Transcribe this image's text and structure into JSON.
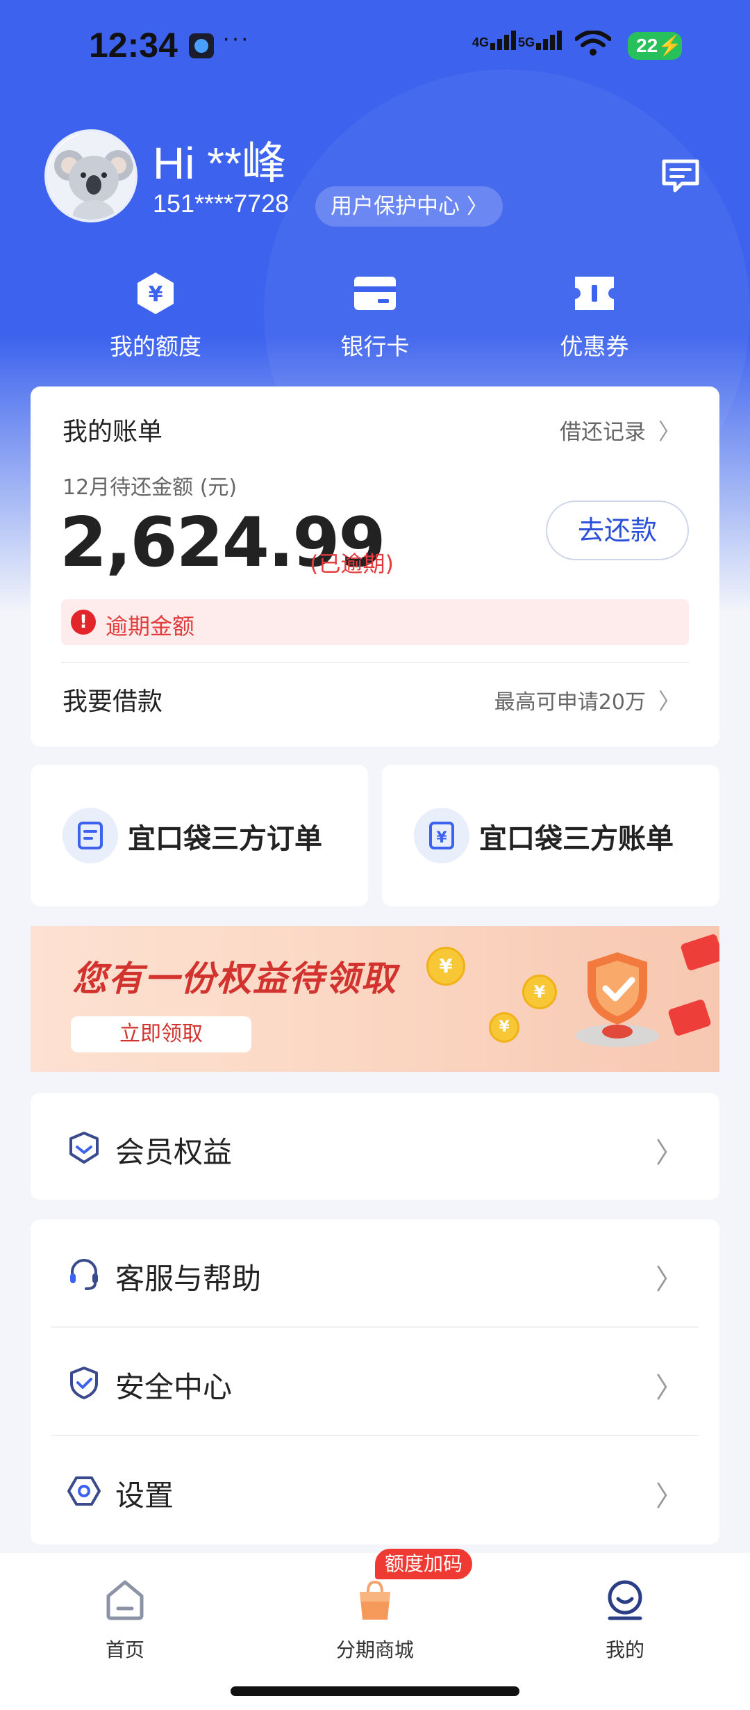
{
  "status_bar": {
    "time": "12:34",
    "network_1": "4G",
    "network_2": "5G",
    "battery": "22"
  },
  "profile": {
    "greeting": "Hi **峰",
    "phone": "151****7728",
    "protection_center": "用户保护中心"
  },
  "quick_actions": [
    {
      "label": "我的额度",
      "icon": "credit-limit-icon"
    },
    {
      "label": "银行卡",
      "icon": "bank-card-icon"
    },
    {
      "label": "优惠券",
      "icon": "coupon-icon"
    }
  ],
  "bill": {
    "title": "我的账单",
    "record_link": "借还记录",
    "subtitle": "12月待还金额 (元)",
    "amount": "2,624.99",
    "status": "(已逾期)",
    "repay_button": "去还款",
    "overdue_label": "逾期金额",
    "borrow_title": "我要借款",
    "borrow_hint": "最高可申请20万"
  },
  "third_party": {
    "orders": "宜口袋三方订单",
    "bills": "宜口袋三方账单"
  },
  "banner": {
    "title": "您有一份权益待领取",
    "button": "立即领取"
  },
  "menu": {
    "membership": "会员权益",
    "support": "客服与帮助",
    "security": "安全中心",
    "settings": "设置"
  },
  "tabbar": {
    "home": "首页",
    "mall": "分期商城",
    "mine": "我的",
    "promo_badge": "额度加码"
  },
  "colors": {
    "primary": "#3d63ee",
    "danger": "#e23b3b",
    "background": "#f3f5fa"
  }
}
